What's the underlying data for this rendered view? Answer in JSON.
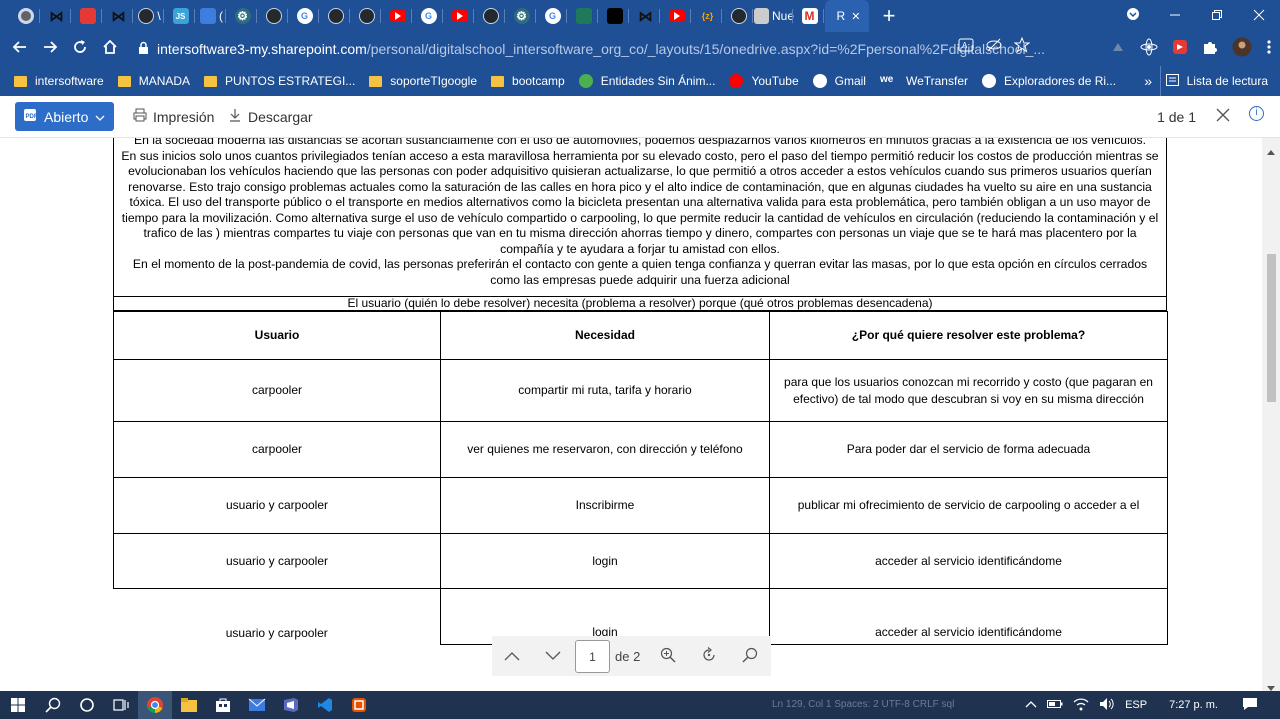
{
  "browser": {
    "tabs": [
      {
        "icon": "chrome-icon",
        "color": "#5f6368",
        "text": ""
      },
      {
        "icon": "bow-icon",
        "color": "#222222",
        "text": ""
      },
      {
        "icon": "ruby-icon",
        "color": "#e53935",
        "text": ""
      },
      {
        "icon": "bow-icon",
        "color": "#222222",
        "text": ""
      },
      {
        "icon": "github-icon",
        "color": "#24292e",
        "text": "\\"
      },
      {
        "icon": "js-icon",
        "color": "#3aa3d8",
        "text": ""
      },
      {
        "icon": "refresh-icon",
        "color": "#3d7de0",
        "text": "("
      },
      {
        "icon": "gear-icon",
        "color": "#2c6e7f",
        "text": ""
      },
      {
        "icon": "github-icon",
        "color": "#24292e",
        "text": ""
      },
      {
        "icon": "google-icon",
        "color": "#ffffff",
        "text": ""
      },
      {
        "icon": "github-icon",
        "color": "#24292e",
        "text": ""
      },
      {
        "icon": "github-icon",
        "color": "#24292e",
        "text": ""
      },
      {
        "icon": "youtube-icon",
        "color": "#ff0000",
        "text": ""
      },
      {
        "icon": "compass-icon",
        "color": "#ffffff",
        "text": ""
      },
      {
        "icon": "youtube-icon",
        "color": "#ff0000",
        "text": ""
      },
      {
        "icon": "github-icon",
        "color": "#24292e",
        "text": ""
      },
      {
        "icon": "gear-icon",
        "color": "#2c6e7f",
        "text": ""
      },
      {
        "icon": "google-icon",
        "color": "#ffffff",
        "text": ""
      },
      {
        "icon": "copy-icon",
        "color": "#1f7a5c",
        "text": ""
      },
      {
        "icon": "medium-icon",
        "color": "#000000",
        "text": ""
      },
      {
        "icon": "bow-icon",
        "color": "#222222",
        "text": ""
      },
      {
        "icon": "youtube-icon",
        "color": "#ff0000",
        "text": ""
      },
      {
        "icon": "braces-icon",
        "color": "#f0a500",
        "text": "{z}"
      },
      {
        "icon": "github-icon",
        "color": "#24292e",
        "text": ""
      },
      {
        "icon": "page-icon",
        "color": "#cccccc",
        "text": "Nue"
      },
      {
        "icon": "gmail-icon",
        "color": "#d93025",
        "text": ""
      }
    ],
    "active_tab_text": "R",
    "close_glyph": "✕",
    "new_tab_glyph": "+",
    "url_domain": "intersoftware3-my.sharepoint.com",
    "url_path": "/personal/digitalschool_intersoftware_org_co/_layouts/15/onedrive.aspx?id=%2Fpersonal%2Fdigitalschool_...",
    "bookmarks": [
      {
        "label": "intersoftware",
        "icon": "folder-icon"
      },
      {
        "label": "MANADA",
        "icon": "folder-icon"
      },
      {
        "label": "PUNTOS ESTRATEGI...",
        "icon": "folder-icon"
      },
      {
        "label": "soporteTIgoogle",
        "icon": "folder-icon"
      },
      {
        "label": "bootcamp",
        "icon": "folder-icon"
      },
      {
        "label": "Entidades Sin Ánim...",
        "icon": "leaf-icon"
      },
      {
        "label": "YouTube",
        "icon": "youtube-icon"
      },
      {
        "label": "Gmail",
        "icon": "google-icon"
      },
      {
        "label": "WeTransfer",
        "icon": "we-icon"
      },
      {
        "label": "Exploradores de Ri...",
        "icon": "wordpress-icon"
      }
    ],
    "bookmarks_more": "»",
    "reading_list": "Lista de lectura"
  },
  "pdf_toolbar": {
    "open_label": "Abierto",
    "print_label": "Impresión",
    "download_label": "Descargar",
    "page_count": "1 de 1"
  },
  "document": {
    "cut_line": "En la sociedad moderna las distancias se acortan sustancialmente con el uso de automóviles, podemos desplazarnos varios kilómetros en minutos gracias a la existencia de los vehículos.",
    "paragraph1": "En sus inicios solo unos cuantos privilegiados tenían acceso a esta maravillosa herramienta por su elevado costo, pero el paso del tiempo permitió reducir los costos de producción mientras se evolucionaban los vehículos haciendo que las personas con poder adquisitivo quisieran actualizarse, lo que permitió a otros acceder a estos vehículos cuando sus primeros usuarios querían renovarse. Esto trajo consigo problemas actuales como la saturación de las calles en hora pico y el alto indice de contaminación, que en algunas ciudades ha vuelto su aire en una sustancia tóxica. El uso del transporte público o el transporte en medios alternativos como la bicicleta presentan una alternativa valida para esta problemática, pero también obligan a un uso mayor de tiempo para la movilización. Como alternativa surge el uso de vehículo compartido o carpooling, lo que permite reducir la cantidad de vehículos en circulación (reduciendo la contaminación y el trafico de las  ) mientras compartes tu viaje con personas que van  en tu misma dirección ahorras tiempo y  dinero,  compartes con personas un viaje que se te hará mas placentero por la compañía y te ayudara a forjar tu amistad con ellos.",
    "paragraph2": "En el momento de la post-pandemia de covid, las personas preferirán el contacto con gente a quien tenga confianza y querran evitar las masas, por lo que esta opción en círculos cerrados como las empresas puede adquirir una fuerza adicional",
    "table_title": "El usuario (quién lo debe resolver) necesita (problema a resolver) porque (qué otros problemas desencadena)",
    "headers": [
      "Usuario",
      "Necesidad",
      "¿Por qué quiere resolver este problema?"
    ],
    "rows": [
      [
        "carpooler",
        "compartir mi ruta, tarifa  y horario",
        "para que los usuarios conozcan mi recorrido y costo (que pagaran en efectivo) de tal modo que descubran si voy en su misma dirección"
      ],
      [
        "carpooler",
        "ver quienes me reservaron, con dirección y teléfono",
        "Para poder dar el servicio de forma adecuada"
      ],
      [
        "usuario y carpooler",
        "Inscribirme",
        "publicar mi ofrecimiento de servicio de carpooling o acceder a el"
      ],
      [
        "usuario y carpooler",
        "login",
        "acceder al servicio identificándome"
      ],
      [
        "usuario y carpooler",
        "login",
        "acceder al servicio identificándome"
      ]
    ]
  },
  "page_nav": {
    "page_value": "1",
    "of_pages": "de 2"
  },
  "taskbar": {
    "status_text": "Ln 129, Col 1   Spaces: 2   UTF-8   CRLF   sql",
    "language": "ESP",
    "time": "7:27 p. m."
  }
}
